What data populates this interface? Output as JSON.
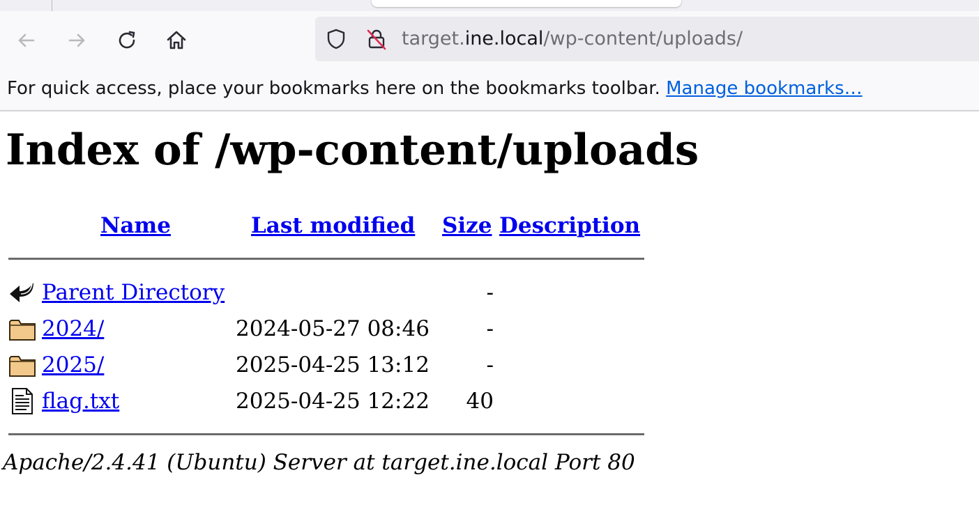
{
  "browser": {
    "url": {
      "prefix": "target.",
      "host_strong": "ine.local",
      "path": "/wp-content/uploads/"
    },
    "icons": {
      "back": "arrow-left-icon",
      "forward": "arrow-right-icon",
      "reload": "reload-icon",
      "home": "home-icon",
      "shield": "shield-icon",
      "insecure_lock": "insecure-lock-icon"
    },
    "bookmarks_bar": {
      "message": "For quick access, place your bookmarks here on the bookmarks toolbar.",
      "link": "Manage bookmarks…"
    }
  },
  "page": {
    "title": "Index of /wp-content/uploads",
    "columns": {
      "name": "Name",
      "last_modified": "Last modified",
      "size": "Size",
      "description": "Description"
    },
    "rows": [
      {
        "icon": "back-arrow-icon",
        "name": "Parent Directory",
        "modified": "",
        "size": "-"
      },
      {
        "icon": "folder-icon",
        "name": "2024/",
        "modified": "2024-05-27 08:46",
        "size": "-"
      },
      {
        "icon": "folder-icon",
        "name": "2025/",
        "modified": "2025-04-25 13:12",
        "size": "-"
      },
      {
        "icon": "text-file-icon",
        "name": "flag.txt",
        "modified": "2025-04-25 12:22",
        "size": "40"
      }
    ],
    "address": "Apache/2.4.41 (Ubuntu) Server at target.ine.local Port 80"
  },
  "colors": {
    "link": "#0000ee",
    "chrome_link": "#0060df",
    "chrome_bg": "#f9f9fb",
    "urlbar_bg": "#ebebef",
    "folder_fill": "#f3c98b"
  }
}
